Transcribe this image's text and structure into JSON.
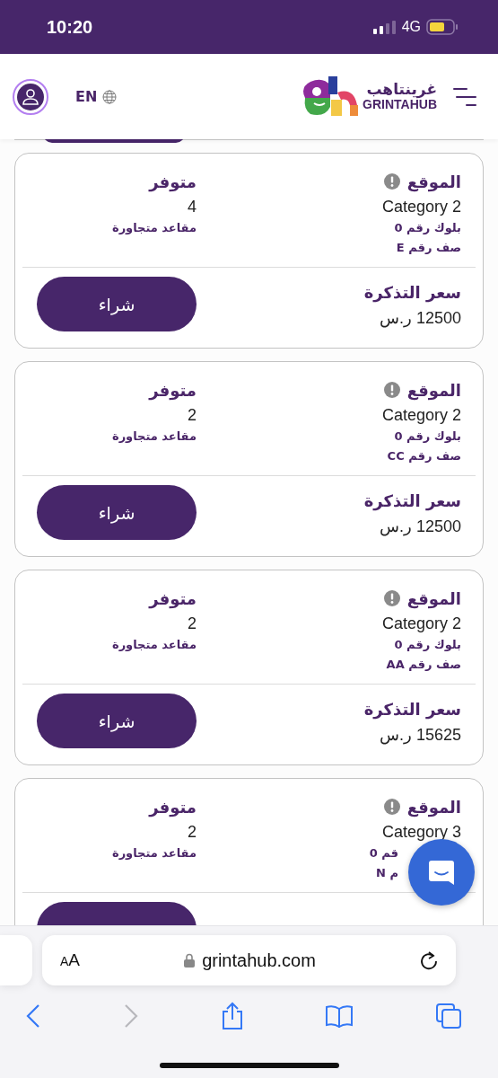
{
  "status_bar": {
    "time": "10:20",
    "network": "4G"
  },
  "header": {
    "language": "EN",
    "logo_arabic": "غرينتاهب",
    "logo_latin": "GRINTAHUB"
  },
  "tickets": [
    {
      "location_label": "الموقع",
      "category": "Category 2",
      "block": "بلوك رقم 0",
      "row": "صف رقم E",
      "available_label": "متوفر",
      "available": "4",
      "seats_note": "مقاعد متجاورة",
      "price_label": "سعر التذكرة",
      "price": "12500 ر.س",
      "buy": "شراء"
    },
    {
      "location_label": "الموقع",
      "category": "Category 2",
      "block": "بلوك رقم 0",
      "row": "صف رقم CC",
      "available_label": "متوفر",
      "available": "2",
      "seats_note": "مقاعد متجاورة",
      "price_label": "سعر التذكرة",
      "price": "12500 ر.س",
      "buy": "شراء"
    },
    {
      "location_label": "الموقع",
      "category": "Category 2",
      "block": "بلوك رقم 0",
      "row": "صف رقم AA",
      "available_label": "متوفر",
      "available": "2",
      "seats_note": "مقاعد متجاورة",
      "price_label": "سعر التذكرة",
      "price": "15625 ر.س",
      "buy": "شراء"
    },
    {
      "location_label": "الموقع",
      "category": "Category 3",
      "block": "قم 0",
      "row": "م N",
      "available_label": "متوفر",
      "available": "2",
      "seats_note": "مقاعد متجاورة",
      "partial": true
    }
  ],
  "browser": {
    "text_size": "AA",
    "url": "grintahub.com",
    "back_enabled": true,
    "forward_enabled": false
  }
}
